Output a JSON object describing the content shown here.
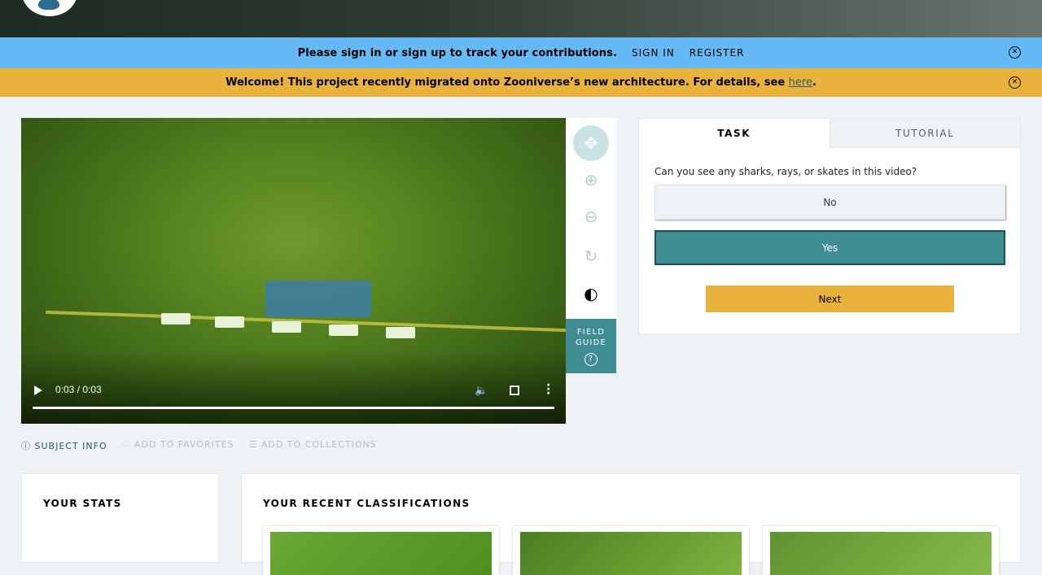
{
  "banner_signin": {
    "message": "Please sign in or sign up to track your contributions.",
    "sign_in": "SIGN IN",
    "register": "REGISTER"
  },
  "banner_migration": {
    "message": "Welcome! This project recently migrated onto Zooniverse’s new architecture. For details, see ",
    "link": "here",
    "suffix": "."
  },
  "video": {
    "time": "0:03 / 0:03",
    "progress": 1.0
  },
  "toolbar": {
    "field_guide": "FIELD GUIDE",
    "help_icon": "?"
  },
  "subject_actions": {
    "info": "SUBJECT INFO",
    "favorites": "ADD TO FAVORITES",
    "collections": "ADD TO COLLECTIONS"
  },
  "task": {
    "tabs": [
      "TASK",
      "TUTORIAL"
    ],
    "question": "Can you see any sharks, rays, or skates in this video?",
    "answers": [
      "No",
      "Yes"
    ],
    "selected": "Yes",
    "next": "Next"
  },
  "stats": {
    "title": "YOUR STATS"
  },
  "recent": {
    "title": "YOUR RECENT CLASSIFICATIONS"
  },
  "colors": {
    "banner_blue": "#65b9f5",
    "banner_yellow": "#e8b23c",
    "teal": "#3f8d93"
  }
}
